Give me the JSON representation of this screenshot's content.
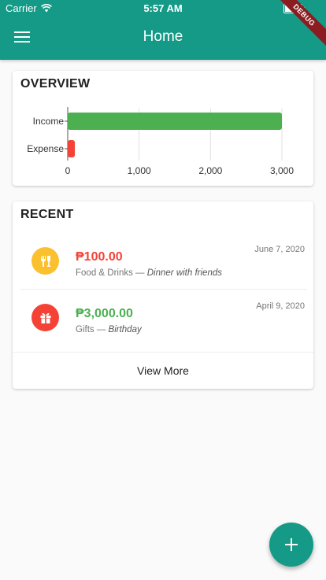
{
  "status_bar": {
    "carrier": "Carrier",
    "time": "5:57 AM",
    "wifi_icon": "wifi-icon",
    "battery_icon": "battery-icon"
  },
  "app_bar": {
    "title": "Home",
    "menu_icon": "menu-icon",
    "debug_banner": "DEBUG",
    "color": "#159a87"
  },
  "overview": {
    "title": "OVERVIEW",
    "chart_data": {
      "type": "bar",
      "orientation": "horizontal",
      "categories": [
        "Income",
        "Expense"
      ],
      "values": [
        3000,
        100
      ],
      "colors": [
        "#4caf50",
        "#f44336"
      ],
      "xlim": [
        0,
        3000
      ],
      "xticks": [
        "0",
        "1,000",
        "2,000",
        "3,000"
      ],
      "grid": true
    }
  },
  "recent": {
    "title": "RECENT",
    "transactions": [
      {
        "amount": "₱100.00",
        "category": "Food & Drinks",
        "separator": " — ",
        "note": "Dinner with friends",
        "date": "June 7, 2020",
        "type": "expense",
        "icon": "utensils-icon",
        "icon_color": "#fbc02d",
        "amount_color": "#f44336"
      },
      {
        "amount": "₱3,000.00",
        "category": "Gifts",
        "separator": " — ",
        "note": "Birthday",
        "date": "April 9, 2020",
        "type": "income",
        "icon": "gift-icon",
        "icon_color": "#f44336",
        "amount_color": "#4caf50"
      }
    ],
    "view_more_label": "View More"
  },
  "fab": {
    "icon": "plus-icon"
  }
}
